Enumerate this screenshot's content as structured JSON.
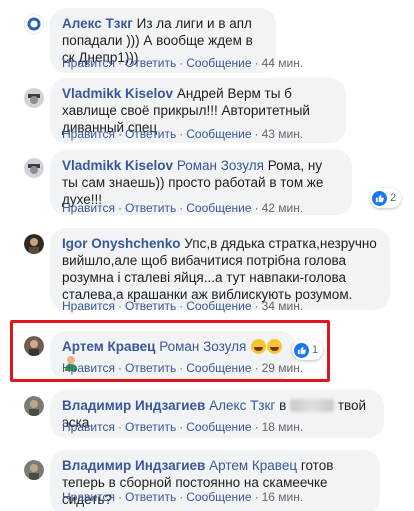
{
  "actions": {
    "like": "Нравится",
    "reply": "Ответить",
    "message": "Сообщение",
    "separator": "·"
  },
  "comments": [
    {
      "author": "Алекс Тзкг",
      "text": "Из ла лиги и в апл попадали ))) А вообще ждем в ск Днепр1)))",
      "time": "44 мин."
    },
    {
      "author": "Vladmikk Kiselov",
      "text": "Андрей Верм ты б хавлище своё прикрыл!!! Авторитетный диванный спец",
      "time": "43 мин."
    },
    {
      "author": "Vladmikk Kiselov",
      "mention": "Роман Зозуля",
      "text": "Рома, ну ты сам знаешь)) просто работай в том же духе!!!",
      "time": "42 мин.",
      "reactions": "2"
    },
    {
      "author": "Igor Onyshchenko",
      "text": "Упс,в дядька стратка,незручно вийшло,але щоб вибачитися потрібна голова розумна і сталеві яйця...а тут навпаки-голова сталева,а крашанки аж виблискують розумом.",
      "time": "34 мин."
    },
    {
      "author": "Артем Кравец",
      "mention": "Роман Зозуля",
      "time": "29 мин.",
      "reactions": "1"
    },
    {
      "author": "Владимир Индзагиев",
      "mention": "Алекс Тзкг",
      "text_before": "в",
      "text_after": "твой эска.",
      "time": "18 мин."
    },
    {
      "author": "Владимир Индзагиев",
      "mention": "Артем Кравец",
      "text": "готов теперь в сборной постоянно на скамеечке сидеть?",
      "time": "16 мин."
    }
  ]
}
